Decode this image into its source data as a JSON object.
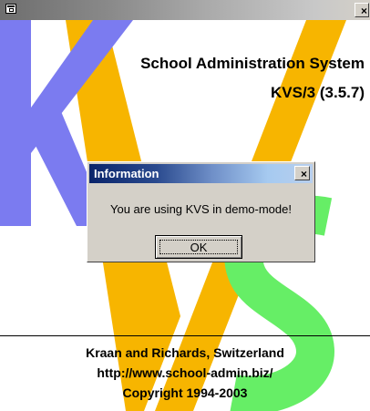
{
  "window": {
    "close_glyph": "×",
    "icon": "app-window-icon"
  },
  "splash": {
    "headline": "School Administration System",
    "version": "KVS/3 (3.5.7)",
    "footer_company": "Kraan and Richards, Switzerland",
    "footer_url": "http://www.school-admin.biz/",
    "footer_copyright": "Copyright 1994-2003",
    "logo_letters": "KVS",
    "colors": {
      "k_letter": "#7b7bf0",
      "v_letter": "#f7b500",
      "s_letter": "#66ee66"
    }
  },
  "dialog": {
    "title": "Information",
    "message": "You are using KVS in demo-mode!",
    "ok_label": "OK",
    "close_glyph": "×"
  }
}
